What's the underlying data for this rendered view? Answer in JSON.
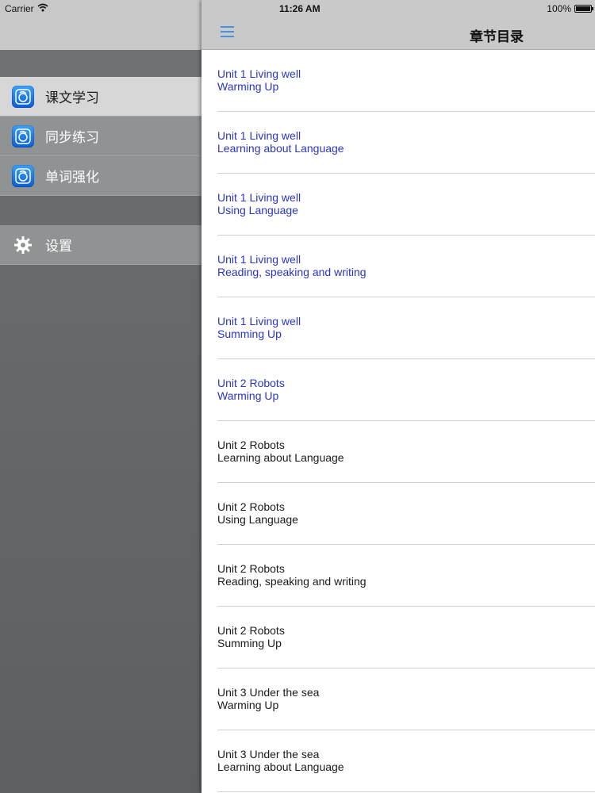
{
  "status_bar": {
    "carrier": "Carrier",
    "time": "11:26 AM",
    "battery": "100%",
    "battery_level": 1.0
  },
  "sidebar": {
    "items": [
      {
        "label": "课文学习",
        "icon": "app-icon",
        "active": true
      },
      {
        "label": "同步练习",
        "icon": "app-icon",
        "active": false
      },
      {
        "label": "单词强化",
        "icon": "app-icon",
        "active": false
      }
    ],
    "settings": {
      "label": "设置",
      "icon": "gear-icon"
    }
  },
  "navbar": {
    "title": "章节目录",
    "menu_icon": "hamburger-icon"
  },
  "colors": {
    "link_blue": "#2a34c8",
    "text_black": "#1a1a1a",
    "accent": "#4a90e2"
  },
  "chapters": [
    {
      "unit": "Unit 1 Living well",
      "section": "Warming Up",
      "style": "blue"
    },
    {
      "unit": "Unit 1 Living well",
      "section": "Learning about Language",
      "style": "blue"
    },
    {
      "unit": "Unit 1 Living well",
      "section": "Using Language",
      "style": "blue"
    },
    {
      "unit": "Unit 1 Living well",
      "section": "Reading, speaking and writing",
      "style": "blue"
    },
    {
      "unit": "Unit 1 Living well",
      "section": "Summing Up",
      "style": "blue"
    },
    {
      "unit": "Unit 2 Robots",
      "section": "Warming Up",
      "style": "blue"
    },
    {
      "unit": "Unit 2 Robots",
      "section": "Learning about Language",
      "style": "black"
    },
    {
      "unit": "Unit 2 Robots",
      "section": "Using Language",
      "style": "black"
    },
    {
      "unit": "Unit 2 Robots",
      "section": "Reading, speaking and writing",
      "style": "black"
    },
    {
      "unit": "Unit 2 Robots",
      "section": "Summing Up",
      "style": "black"
    },
    {
      "unit": "Unit 3 Under the sea",
      "section": "Warming Up",
      "style": "black"
    },
    {
      "unit": "Unit 3 Under the sea",
      "section": "Learning about Language",
      "style": "black"
    }
  ]
}
